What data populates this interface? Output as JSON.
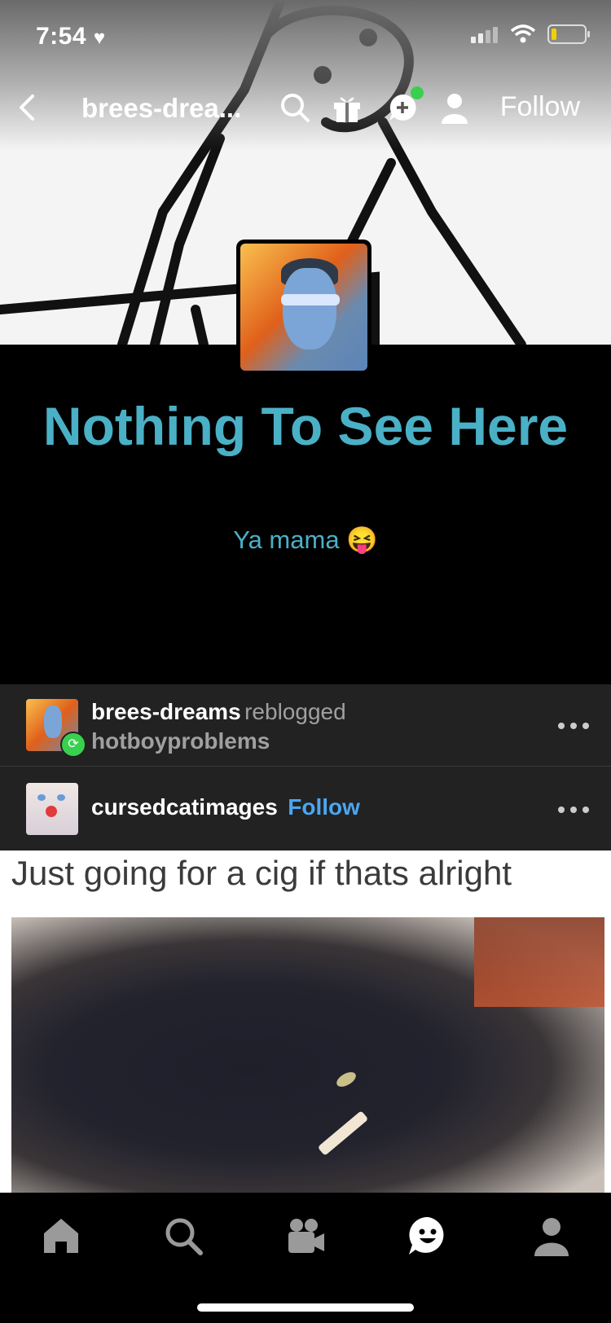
{
  "status": {
    "time": "7:54"
  },
  "nav": {
    "title": "brees-drea...",
    "follow_label": "Follow"
  },
  "blog": {
    "title": "Nothing To See Here",
    "description": "Ya mama 😝"
  },
  "post": {
    "reblogger": "brees-dreams",
    "reblog_verb": "reblogged",
    "source": "hotboyproblems",
    "author": "cursedcatimages",
    "follow_label": "Follow",
    "caption": "Just going for a cig if thats alright"
  },
  "tabs": [
    "home-icon",
    "search-icon",
    "video-icon",
    "activity-icon",
    "account-icon"
  ]
}
